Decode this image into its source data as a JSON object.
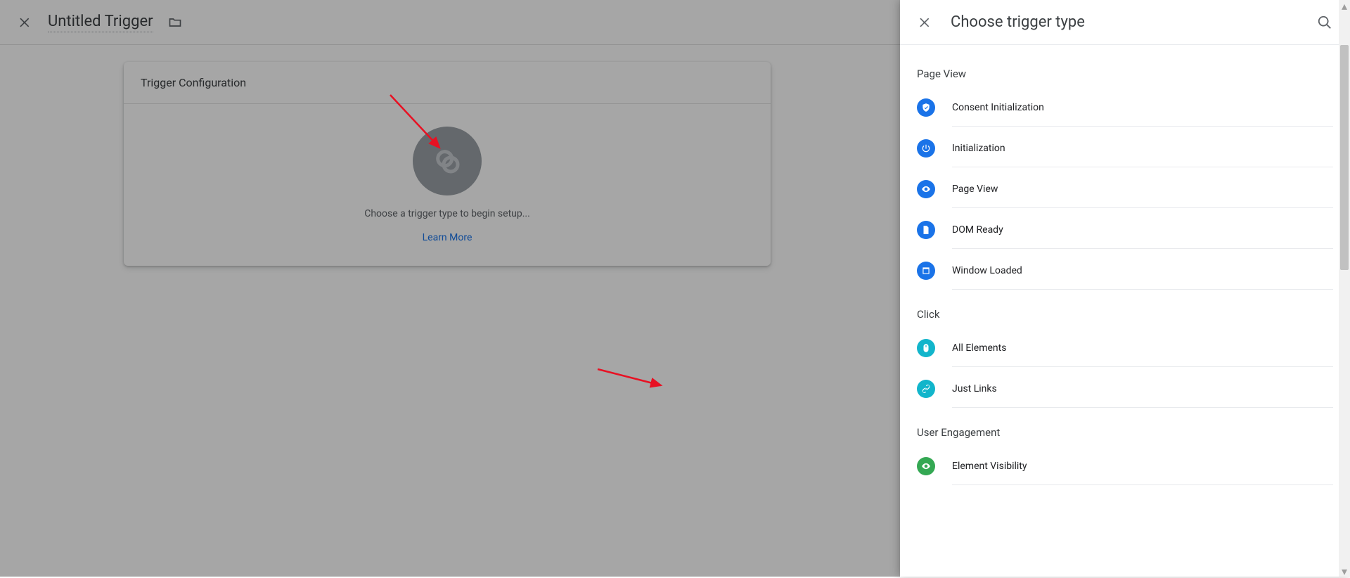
{
  "bg": {
    "title": "Untitled Trigger",
    "card_title": "Trigger Configuration",
    "card_hint": "Choose a trigger type to begin setup...",
    "learn": "Learn More"
  },
  "panel": {
    "title": "Choose trigger type",
    "sections": [
      {
        "label": "Page View",
        "items": [
          {
            "name": "Consent Initialization",
            "icon": "shield",
            "color": "blue"
          },
          {
            "name": "Initialization",
            "icon": "power",
            "color": "blue"
          },
          {
            "name": "Page View",
            "icon": "eye",
            "color": "blue"
          },
          {
            "name": "DOM Ready",
            "icon": "doc",
            "color": "blue"
          },
          {
            "name": "Window Loaded",
            "icon": "frame",
            "color": "blue"
          }
        ]
      },
      {
        "label": "Click",
        "items": [
          {
            "name": "All Elements",
            "icon": "mouse",
            "color": "cyan"
          },
          {
            "name": "Just Links",
            "icon": "link",
            "color": "cyan"
          }
        ]
      },
      {
        "label": "User Engagement",
        "items": [
          {
            "name": "Element Visibility",
            "icon": "eye",
            "color": "green"
          }
        ]
      }
    ]
  }
}
